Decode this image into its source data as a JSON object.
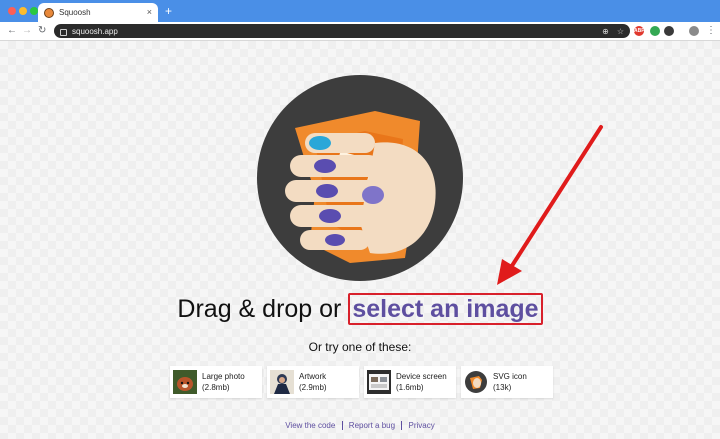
{
  "browser": {
    "tab_title": "Squoosh",
    "tab_close": "×",
    "new_tab": "+",
    "url": "squoosh.app",
    "extensions": {
      "abp": "ABP",
      "green": "●",
      "dark": "●",
      "menu": "⋮"
    }
  },
  "page": {
    "headline_prefix": "Drag & drop or",
    "select_link": "select an image",
    "subhead": "Or try one of these:",
    "samples": [
      {
        "name": "Large photo",
        "size": "(2.8mb)",
        "thumb": "red-panda"
      },
      {
        "name": "Artwork",
        "size": "(2.9mb)",
        "thumb": "artwork"
      },
      {
        "name": "Device screen",
        "size": "(1.6mb)",
        "thumb": "device-screen"
      },
      {
        "name": "SVG icon",
        "size": "(13k)",
        "thumb": "svg-icon"
      }
    ],
    "footer": [
      "View the code",
      "Report a bug",
      "Privacy"
    ]
  },
  "colors": {
    "tabstrip": "#4a8fe7",
    "link": "#5e4fa0",
    "highlight_box": "#d8202b",
    "arrow": "#e01b1b",
    "logo_orange": "#f08a2c"
  }
}
